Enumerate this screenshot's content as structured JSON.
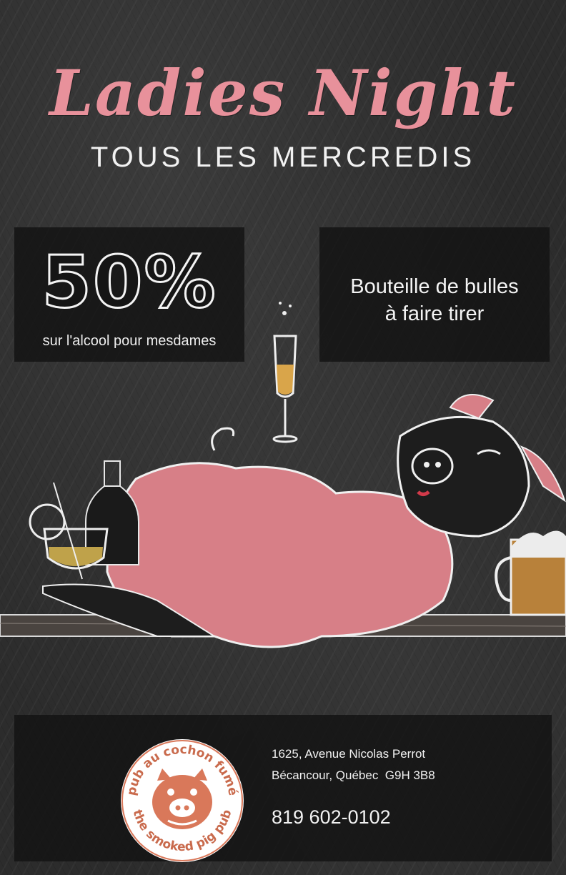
{
  "poster": {
    "title": "Ladies Night",
    "subtitle": "TOUS LES MERCREDIS"
  },
  "promo_left": {
    "headline": "50%",
    "caption": "sur l'alcool pour mesdames"
  },
  "promo_right": {
    "line1": "Bouteille de bulles",
    "line2": "à faire tirer"
  },
  "contact": {
    "address_line1": "1625, Avenue Nicolas Perrot",
    "address_line2": "Bécancour, Québec  G9H 3B8",
    "phone": "819 602-0102"
  },
  "logo": {
    "text_top": "pub au cochon fumé",
    "text_bottom": "the smoked pig pub",
    "icon": "pig-face-icon"
  },
  "colors": {
    "pink_accent": "#e8919b",
    "chalkboard": "#2c2c2c",
    "logo_orange": "#d9785a"
  }
}
